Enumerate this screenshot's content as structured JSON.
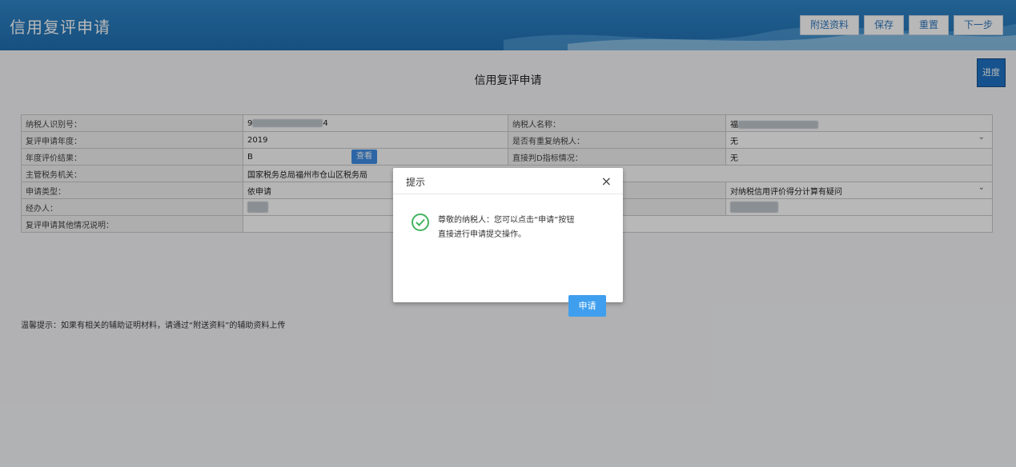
{
  "header": {
    "title": "信用复评申请",
    "actions": [
      "附送资料",
      "保存",
      "重置",
      "下一步"
    ]
  },
  "page": {
    "heading": "信用复评申请",
    "progress_label": "进度"
  },
  "form": {
    "rows": [
      {
        "l1": "纳税人识别号：",
        "v1": "9",
        "v1b": "4",
        "l2": "纳税人名称：",
        "v2": "福"
      },
      {
        "l1": "复评申请年度：",
        "v1": "2019",
        "l2": "是否有重复纳税人：",
        "v2": "无"
      },
      {
        "l1": "年度评价结果：",
        "v1": "B",
        "view": "查看",
        "l2": "直接判D指标情况：",
        "v2": "无"
      },
      {
        "l1": "主管税务机关：",
        "v1": "国家税务总局福州市仓山区税务局"
      },
      {
        "l1": "申请类型：",
        "v1": "依申请",
        "v2": "对纳税信用评价得分计算有疑问"
      },
      {
        "l1": "经办人："
      },
      {
        "l1": "复评申请其他情况说明："
      }
    ]
  },
  "hint": "温馨提示：如果有相关的辅助证明材料，请通过“附送资料”的辅助资料上传",
  "modal": {
    "title": "提示",
    "message_line1": "尊敬的纳税人：您可以点击“申请”按钮",
    "message_line2": "直接进行申请提交操作。",
    "button": "申请",
    "close": "×"
  },
  "colors": {
    "header_blue": "#1f6fb2",
    "success_green": "#41b35f",
    "primary_button": "#3f9fee"
  }
}
